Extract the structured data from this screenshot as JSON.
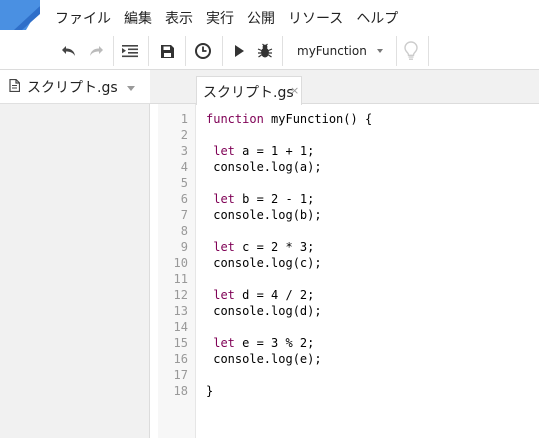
{
  "menu": {
    "items": [
      "ファイル",
      "編集",
      "表示",
      "実行",
      "公開",
      "リソース",
      "ヘルプ"
    ]
  },
  "toolbar": {
    "function_select": "myFunction"
  },
  "sidebar": {
    "file_name": "スクリプト.gs"
  },
  "tab": {
    "label": "スクリプト.gs",
    "close": "×"
  },
  "code": {
    "lines": [
      {
        "n": "1",
        "kw": "function",
        "rest": " myFunction() {"
      },
      {
        "n": "2",
        "kw": "",
        "rest": ""
      },
      {
        "n": "3",
        "kw": " let",
        "rest": " a = 1 + 1;"
      },
      {
        "n": "4",
        "kw": "",
        "rest": " console.log(a);"
      },
      {
        "n": "5",
        "kw": "",
        "rest": ""
      },
      {
        "n": "6",
        "kw": " let",
        "rest": " b = 2 - 1;"
      },
      {
        "n": "7",
        "kw": "",
        "rest": " console.log(b);"
      },
      {
        "n": "8",
        "kw": "",
        "rest": ""
      },
      {
        "n": "9",
        "kw": " let",
        "rest": " c = 2 * 3;"
      },
      {
        "n": "10",
        "kw": "",
        "rest": " console.log(c);"
      },
      {
        "n": "11",
        "kw": "",
        "rest": ""
      },
      {
        "n": "12",
        "kw": " let",
        "rest": " d = 4 / 2;"
      },
      {
        "n": "13",
        "kw": "",
        "rest": " console.log(d);"
      },
      {
        "n": "14",
        "kw": "",
        "rest": ""
      },
      {
        "n": "15",
        "kw": " let",
        "rest": " e = 3 % 2;"
      },
      {
        "n": "16",
        "kw": "",
        "rest": " console.log(e);"
      },
      {
        "n": "17",
        "kw": "",
        "rest": ""
      },
      {
        "n": "18",
        "kw": "",
        "rest": "}"
      }
    ]
  },
  "icons": {
    "undo": "undo-icon",
    "redo": "redo-icon",
    "indent": "indent-icon",
    "save": "save-icon",
    "triggers": "clock-icon",
    "run": "run-icon",
    "debug": "bug-icon",
    "hint": "lightbulb-icon"
  },
  "colors": {
    "logo_blue": "#4285f4",
    "keyword": "#7f0055"
  }
}
